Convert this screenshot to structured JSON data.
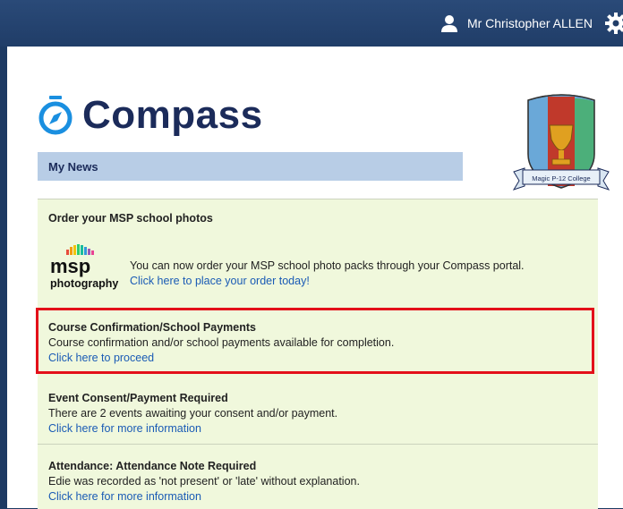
{
  "header": {
    "user_name": "Mr Christopher ALLEN"
  },
  "logo": {
    "text": "Compass"
  },
  "crest": {
    "label": "Magic P-12 College"
  },
  "news": {
    "heading": "My News",
    "items": [
      {
        "title": "Order your MSP school photos",
        "desc": "You can now order your MSP school photo packs through your Compass portal.",
        "link": "Click here to place your order today!"
      },
      {
        "title": "Course Confirmation/School Payments",
        "desc": "Course confirmation and/or school payments available for completion.",
        "link": "Click here to proceed"
      },
      {
        "title": "Event Consent/Payment Required",
        "desc": "There are 2 events awaiting your consent and/or payment.",
        "link": "Click here for more information"
      },
      {
        "title": "Attendance: Attendance Note Required",
        "desc": "Edie was recorded as 'not present' or 'late' without explanation.",
        "link": "Click here for more information"
      }
    ]
  },
  "msp_logo": {
    "brand": "msp",
    "sub": "photography"
  },
  "colors": {
    "highlight": "#e3101a",
    "accent": "#1a8fe0",
    "link": "#1a5bb5"
  }
}
